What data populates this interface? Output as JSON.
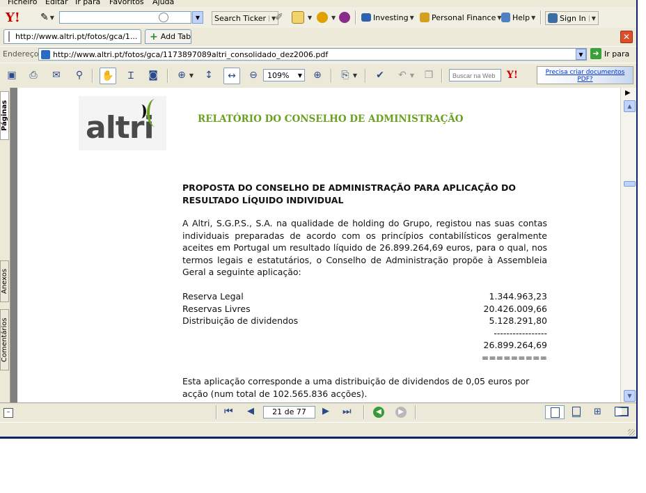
{
  "menu": [
    "Ficheiro",
    "Editar",
    "Ir para",
    "Favoritos",
    "Ajuda"
  ],
  "yahoo_toolbar": {
    "logo": "Y!",
    "search_value": "",
    "search_ticker": "Search Ticker",
    "investing": "Investing",
    "personal_finance": "Personal Finance",
    "help": "Help",
    "sign_in": "Sign In"
  },
  "tabs": {
    "active_tab": "http://www.altri.pt/fotos/gca/1...",
    "add_tab": "Add Tab"
  },
  "address": {
    "label": "Endereço",
    "url": "http://www.altri.pt/fotos/gca/1173897089altri_consolidado_dez2006.pdf",
    "go": "Ir para"
  },
  "pdf_toolbar": {
    "zoom": "109%",
    "search_placeholder": "Buscar na Web",
    "promo": "Precisa criar documentos PDF?"
  },
  "side_tabs": [
    "Páginas",
    "Anexos",
    "Comentários"
  ],
  "document": {
    "logo_text": "altri",
    "header": "RELATÓRIO DO CONSELHO DE ADMINISTRAÇÃO",
    "section_title": "PROPOSTA DO CONSELHO DE ADMINISTRAÇÃO PARA APLICAÇÃO DO RESULTADO LÍQUIDO INDIVIDUAL",
    "paragraph": "A Altri, S.G.P.S., S.A. na qualidade de holding do Grupo, registou nas suas contas individuais preparadas de acordo com os princípios contabilísticos geralmente aceites em Portugal um resultado líquido de 26.899.264,69 euros, para o qual, nos termos legais e estatutários, o Conselho de Administração propõe à Assembleia Geral a seguinte aplicação:",
    "allocations": [
      {
        "label": "Reserva Legal",
        "value": "1.344.963,23"
      },
      {
        "label": "Reservas Livres",
        "value": "20.426.009,66"
      },
      {
        "label": "Distribuição de dividendos",
        "value": "5.128.291,80"
      }
    ],
    "dash_line": "-----------------",
    "total": "26.899.264,69",
    "equals_line": "=========",
    "closing": "Esta aplicação corresponde a uma distribuição de dividendos de 0,05 euros por acção (num total de 102.565.836 acções)."
  },
  "navigation": {
    "page_indicator": "21 de 77"
  },
  "colors": {
    "accent_green": "#6aa121",
    "title_blue": "#0a246a"
  }
}
